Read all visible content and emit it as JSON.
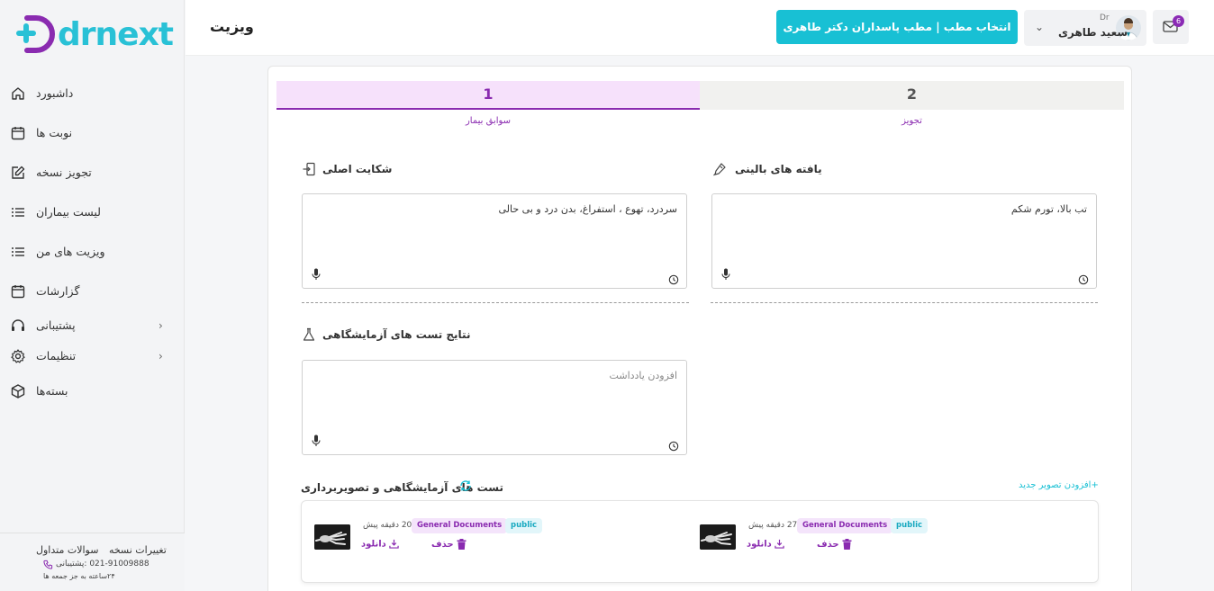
{
  "brand": {
    "logo_text": "drnext",
    "accent": "#18c0d4",
    "purple": "#8a2bb0"
  },
  "header": {
    "page_title": "ویزیت",
    "clinic_button": "انتخاب مطب | مطب پاسداران دکتر طاهری",
    "user_title": "Dr",
    "user_name": "سعید طاهری",
    "mail_badge": "6"
  },
  "sidebar": {
    "items": [
      {
        "label": "داشبورد",
        "icon": "home-icon"
      },
      {
        "label": "نوبت ها",
        "icon": "calendar-icon"
      },
      {
        "label": "تجویز نسخه",
        "icon": "edit-icon"
      },
      {
        "label": "لیست بیماران",
        "icon": "list-icon"
      },
      {
        "label": "ویزیت های من",
        "icon": "list-icon"
      },
      {
        "label": "گزارشات",
        "icon": "calendar-icon"
      },
      {
        "label": "پشتیبانی",
        "icon": "headset-icon"
      },
      {
        "label": "تنظیمات",
        "icon": "gear-icon"
      },
      {
        "label": "بسته‌ها",
        "icon": "package-icon"
      }
    ],
    "footer": {
      "faq": "سوالات متداول",
      "changes": "تغییرات نسخه",
      "phone": "021-91009888 :پشتیبانی",
      "hours": "۲۴ساعته به جز جمعه ها"
    }
  },
  "steps": [
    {
      "number": "1",
      "label": "سوابق بیمار"
    },
    {
      "number": "2",
      "label": "تجویز"
    }
  ],
  "fields": {
    "clinical_findings": {
      "title": "یافته های بالینی",
      "value": "تب بالا، تورم شکم"
    },
    "chief_complaint": {
      "title": "شکایت اصلی",
      "value": "سردرد، تهوع ، استفراغ، بدن درد و بی حالی"
    },
    "lab_results": {
      "title": "نتایج تست های آزمایشگاهی",
      "placeholder": "افزودن یادداشت"
    }
  },
  "imaging": {
    "title": "تست های آزمایشگاهی و تصویربرداری",
    "add_link": "+افزودن تصویر جدید",
    "files": [
      {
        "time": "20 دقیقه پیش",
        "category": "General Documents",
        "visibility": "public",
        "delete": "حذف",
        "download": "دانلود"
      },
      {
        "time": "27 دقیقه پیش",
        "category": "General Documents",
        "visibility": "public",
        "delete": "حذف",
        "download": "دانلود"
      }
    ]
  }
}
